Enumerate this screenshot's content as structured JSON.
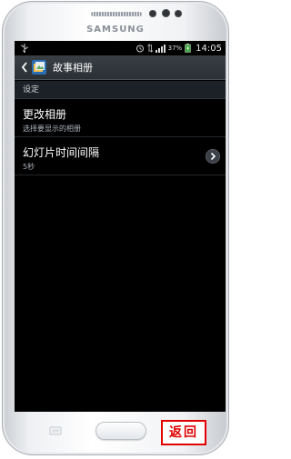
{
  "device": {
    "brand": "SAMSUNG"
  },
  "status_bar": {
    "battery_percent": "37%",
    "time": "14:05",
    "icons": [
      "usb-icon",
      "alarm-icon",
      "signal-strength-icon",
      "battery-charging-icon"
    ]
  },
  "action_bar": {
    "title": "故事相册",
    "back_icon": "chevron-left-icon",
    "app_icon": "story-album-icon"
  },
  "settings": {
    "section_header": "设定",
    "items": [
      {
        "title": "更改相册",
        "subtitle": "选择要显示的相册"
      },
      {
        "title": "幻灯片时间间隔",
        "subtitle": "5秒",
        "icon": "chevron-right-icon"
      }
    ]
  },
  "annotation": {
    "return_label": "返回",
    "color": "#e00000"
  },
  "colors": {
    "screen_bg": "#000000",
    "action_bar_bg": "#33383e",
    "section_header_bg": "#1c2127"
  }
}
